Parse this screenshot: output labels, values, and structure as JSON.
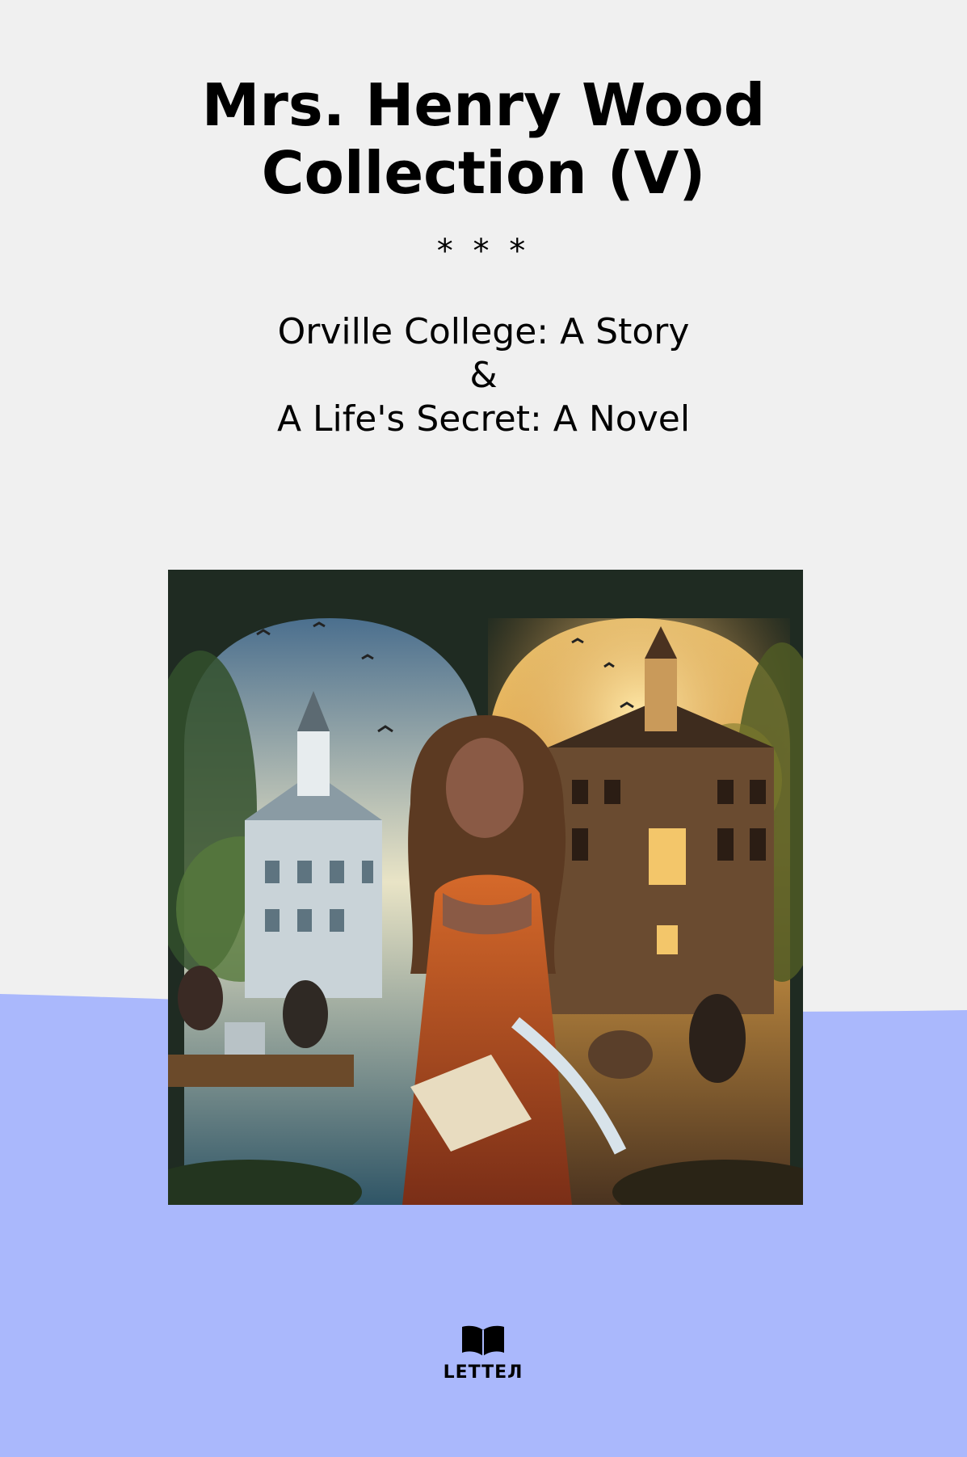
{
  "cover": {
    "title": "Mrs. Henry Wood Collection (V)",
    "separator": "* * *",
    "works": [
      "Orville College: A Story",
      "&",
      "A Life's Secret: A Novel"
    ],
    "illustration_icon": "book-cover-illustration",
    "publisher": {
      "name": "LETTEЛ",
      "icon": "open-book-icon"
    },
    "colors": {
      "background_top": "#f0f0f0",
      "background_bottom": "#aab8fc"
    }
  }
}
